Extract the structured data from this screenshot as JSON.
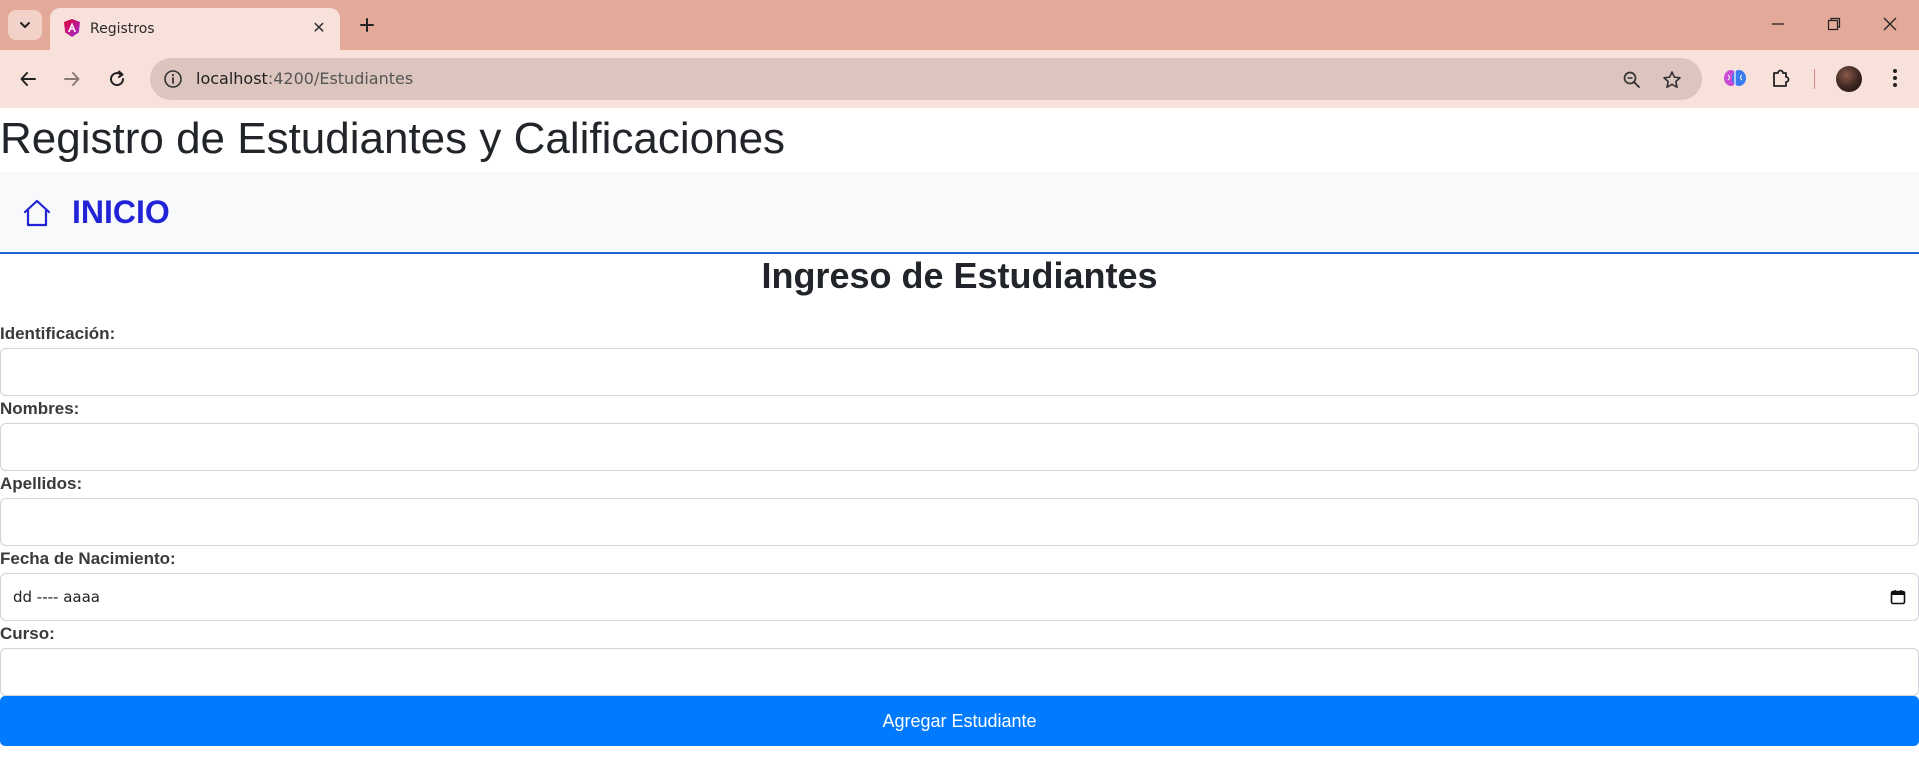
{
  "browser": {
    "tab_title": "Registros",
    "url_host": "localhost",
    "url_rest": ":4200/Estudiantes"
  },
  "page": {
    "title": "Registro de Estudiantes y Calificaciones",
    "nav_link": "INICIO",
    "section_title": "Ingreso de Estudiantes"
  },
  "form": {
    "fields": [
      {
        "label": "Identificación:",
        "value": ""
      },
      {
        "label": "Nombres:",
        "value": ""
      },
      {
        "label": "Apellidos:",
        "value": ""
      },
      {
        "label": "Fecha de Nacimiento:",
        "value": "dd ---- aaaa"
      },
      {
        "label": "Curso:",
        "value": ""
      }
    ],
    "submit_label": "Agregar Estudiante"
  },
  "colors": {
    "primary": "#007bff",
    "nav_link": "#2222d6",
    "tab_strip": "#e3a999",
    "navbar_border": "#1e66d6"
  }
}
